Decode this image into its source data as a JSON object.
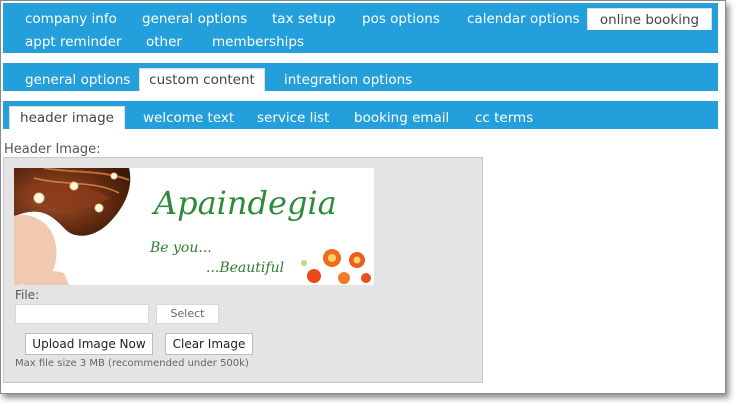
{
  "top_tabs": [
    {
      "label": "company info"
    },
    {
      "label": "general options"
    },
    {
      "label": "tax setup"
    },
    {
      "label": "pos options"
    },
    {
      "label": "calendar options"
    },
    {
      "label": "online booking"
    },
    {
      "label": "appt reminder"
    },
    {
      "label": "other"
    },
    {
      "label": "memberships"
    }
  ],
  "sub_tabs": [
    {
      "label": "general options"
    },
    {
      "label": "custom content"
    },
    {
      "label": "integration options"
    }
  ],
  "content_tabs": [
    {
      "label": "header image"
    },
    {
      "label": "welcome text"
    },
    {
      "label": "service list"
    },
    {
      "label": "booking email"
    },
    {
      "label": "cc terms"
    }
  ],
  "header_image": {
    "section_label": "Header Image:",
    "banner_brand": "Apaindegia",
    "banner_tagline1": "Be you...",
    "banner_tagline2": "...Beautiful",
    "file_label": "File:",
    "file_value": "",
    "select_label": "Select",
    "upload_label": "Upload Image Now",
    "clear_label": "Clear Image",
    "note": "Max file size 3 MB (recommended under 500k)"
  },
  "colors": {
    "tab_bar": "#239fdb",
    "panel": "#e4e4e4"
  }
}
